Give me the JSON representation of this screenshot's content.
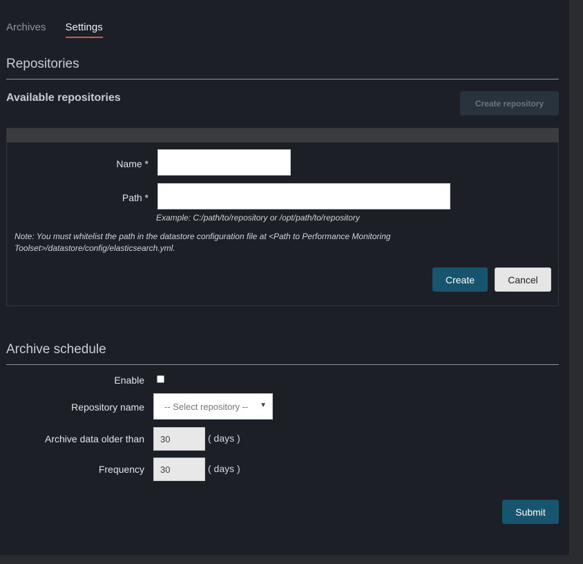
{
  "tabs": [
    {
      "label": "Archives",
      "active": false
    },
    {
      "label": "Settings",
      "active": true
    }
  ],
  "repositories": {
    "title": "Repositories",
    "available_title": "Available repositories",
    "create_repository_label": "Create repository",
    "form": {
      "name_label": "Name *",
      "name_value": "",
      "path_label": "Path *",
      "path_value": "",
      "example": "Example: C:/path/to/repository or /opt/path/to/repository",
      "note": "Note: You must whitelist the path in the datastore configuration file at <Path to Performance Monitoring Toolset>/datastore/config/elasticsearch.yml.",
      "create_label": "Create",
      "cancel_label": "Cancel"
    }
  },
  "archive_schedule": {
    "title": "Archive schedule",
    "enable_label": "Enable",
    "enable_checked": false,
    "repository_label": "Repository name",
    "repository_selected": "-- Select repository --",
    "older_than_label": "Archive data older than",
    "older_than_value": "30",
    "older_than_unit": "( days )",
    "frequency_label": "Frequency",
    "frequency_value": "30",
    "frequency_unit": "( days )",
    "submit_label": "Submit"
  },
  "colors": {
    "background": "#1c2026",
    "primary": "#17556f",
    "tab_underline": "#d9534f"
  }
}
